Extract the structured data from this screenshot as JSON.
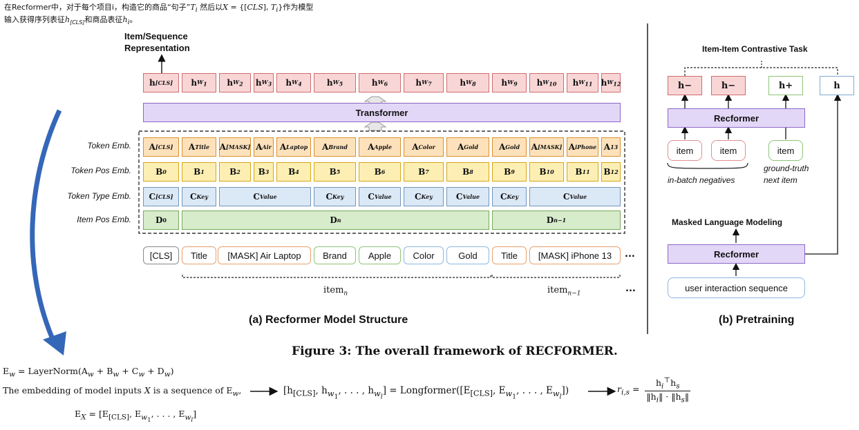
{
  "notes": {
    "line1": "在Recformer中，对于每个项目i，构造它的商品“句子”Tᵢ 然后以X = {[CLS], Tᵢ}作为模型",
    "line2": "输入获得序列表征h[CLS]和商品表征hᵢ。"
  },
  "structure": {
    "output_label_1": "Item/Sequence",
    "output_label_2": "Representation",
    "transformer_label": "Transformer",
    "h_row": [
      "h[CLS]",
      "hW1",
      "hW2",
      "hW3",
      "hW4",
      "hW5",
      "hW6",
      "hW7",
      "hW8",
      "hW9",
      "hW10",
      "hW11",
      "hW12"
    ],
    "row_labels": {
      "token": "Token Emb.",
      "token_pos": "Token Pos Emb.",
      "token_type": "Token Type Emb.",
      "item_pos": "Item Pos Emb."
    },
    "A_row": [
      "A[CLS]",
      "ATitle",
      "A[MASK]",
      "AAir",
      "ALaptop",
      "ABrand",
      "AApple",
      "AColor",
      "AGold",
      "AGold",
      "A[MASK]",
      "AiPhone",
      "A13"
    ],
    "B_row": [
      "B0",
      "B1",
      "B2",
      "B3",
      "B4",
      "B5",
      "B6",
      "B7",
      "B8",
      "B9",
      "B10",
      "B11",
      "B12"
    ],
    "C_row": [
      "C[CLS]",
      "CKey",
      "CValue",
      "CKey",
      "CValue",
      "CKey",
      "CValue",
      "CKey",
      "CValue"
    ],
    "D_row": [
      "D0",
      "Dn",
      "Dn−1"
    ],
    "tokens": [
      "[CLS]",
      "Title",
      "[MASK] Air Laptop",
      "Brand",
      "Apple",
      "Color",
      "Gold",
      "Title",
      "[MASK] iPhone 13",
      "..."
    ],
    "item_n": "item",
    "item_n_sub": "n",
    "item_n1": "item",
    "item_n1_sub": "n−1",
    "ellipsis": "...",
    "caption": "(a) Recformer Model Structure"
  },
  "pretraining": {
    "task_label": "Item-Item Contrastive Task",
    "h_boxes": [
      "h−",
      "h−",
      "h+",
      "h"
    ],
    "recformer_label": "Recformer",
    "items": [
      "item",
      "item",
      "item"
    ],
    "in_batch": "in-batch negatives",
    "ground_truth_1": "ground-truth",
    "ground_truth_2": "next item",
    "mlm_label": "Masked Language Modeling",
    "recformer_label_2": "Recformer",
    "user_seq": "user interaction sequence",
    "caption": "(b) Pretraining"
  },
  "figure_caption": "Figure 3: The overall framework of RECFORMER.",
  "equations": {
    "ew": "E_w = LayerNorm(A_w + B_w + C_w + D_w)",
    "sentence": "The embedding of model inputs X is a sequence of E_w,",
    "ex": "E_X = [E[CLS], E_w1, ..., E_wl]",
    "longformer": "[h[CLS], h_w1, ..., h_wl] = Longformer([E[CLS], E_w1, ..., E_wl])",
    "score": "r_i,s = h_i^T h_s / (||h_i|| · ||h_s||)"
  },
  "colors": {
    "h_red": "#f9d6d6",
    "transformer": "#e3d7f7",
    "token_orange": "#fde1bb",
    "pos_yellow": "#fdefb3",
    "type_blue": "#dbe8f6",
    "item_green": "#d7ecca",
    "arrow_blue": "#3567b8"
  }
}
